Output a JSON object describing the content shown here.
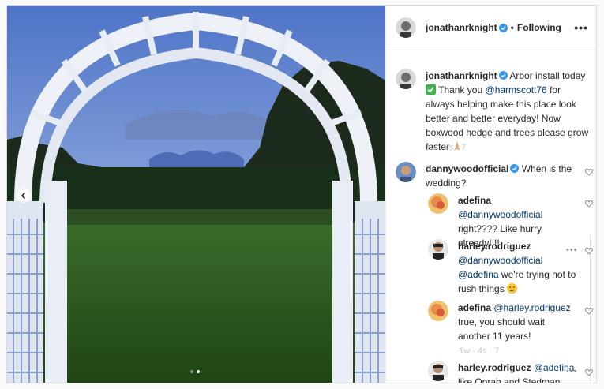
{
  "post": {
    "username": "jonathanrknight",
    "follow_label": "Following",
    "separator": "•",
    "more_label": "•••"
  },
  "caption": {
    "username": "jonathanrknight",
    "text_1": "Arbor install today",
    "text_2": "Thank you",
    "mention": "@harmscott76",
    "text_3": "for always helping make this place look better and better everyday! Now boxwood hedge and trees please grow faster"
  },
  "comments": [
    {
      "username": "dannywoodofficial",
      "text": "When is the wedding?"
    },
    {
      "username": "adefina",
      "mention": "@dannywoodofficial",
      "text": "right???? Like hurry already!!!!"
    },
    {
      "username": "harley.rodriguez",
      "mention": "@dannywoodofficial",
      "mention2": "@adefina",
      "text": "we're trying not to rush things"
    },
    {
      "username": "adefina",
      "mention": "@harley.rodriguez",
      "text": "true, you should wait another 11 years!"
    },
    {
      "username": "harley.rodriguez",
      "mention": "@adefina",
      "text": "like Oprah and Stedman"
    }
  ],
  "faint_meta": "1w  ·  4s  ·  7",
  "carousel": {
    "slides": 2,
    "active": 2
  },
  "colors": {
    "link": "#00376b",
    "verified": "#3897f0",
    "sky": "#7e9fd6",
    "grass": "#2f5a22"
  },
  "icons": [
    "chevron-left-icon",
    "verified-icon",
    "heart-icon",
    "more-icon",
    "check-emoji-icon",
    "pray-emoji-icon",
    "smirk-emoji-icon"
  ]
}
